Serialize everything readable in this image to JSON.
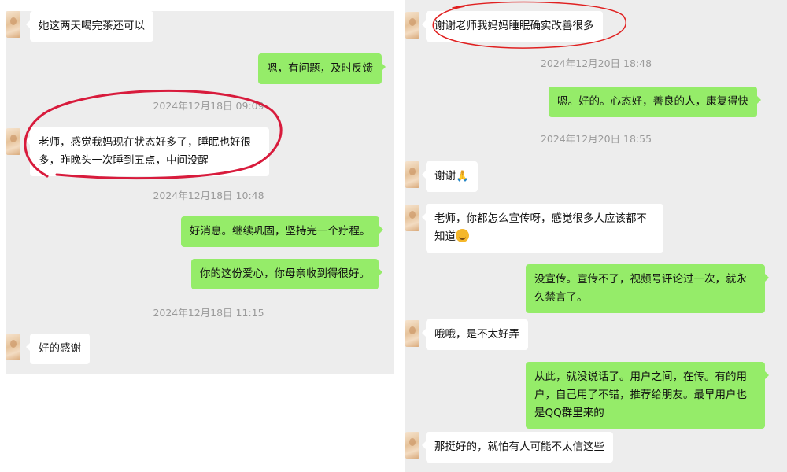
{
  "left": {
    "messages": [
      {
        "side": "in",
        "text": "她这两天喝完茶还可以"
      },
      {
        "side": "out",
        "text": "嗯，有问题，及时反馈"
      },
      {
        "type": "time",
        "text": "2024年12月18日 09:09"
      },
      {
        "side": "in",
        "text": "老师，感觉我妈现在状态好多了，睡眠也好很多，昨晚头一次睡到五点，中间没醒"
      },
      {
        "type": "time",
        "text": "2024年12月18日 10:48"
      },
      {
        "side": "out",
        "text": "好消息。继续巩固，坚持完一个疗程。"
      },
      {
        "side": "out",
        "text": "你的这份爱心，你母亲收到得很好。"
      },
      {
        "type": "time",
        "text": "2024年12月18日 11:15"
      },
      {
        "side": "in",
        "text": "好的感谢"
      }
    ]
  },
  "right": {
    "messages": [
      {
        "side": "in",
        "text": "谢谢老师我妈妈睡眠确实改善很多"
      },
      {
        "type": "time",
        "text": "2024年12月20日 18:48"
      },
      {
        "side": "out",
        "text": "嗯。好的。心态好，善良的人，康复得快"
      },
      {
        "type": "time",
        "text": "2024年12月20日 18:55"
      },
      {
        "side": "in",
        "text": "谢谢",
        "emoji": "🙏"
      },
      {
        "side": "in",
        "text": "老师，你都怎么宣传呀，感觉很多人应该都不知道",
        "emoji": "face-with-tongue"
      },
      {
        "side": "out",
        "text": "没宣传。宣传不了，视频号评论过一次，就永久禁言了。"
      },
      {
        "side": "in",
        "text": "哦哦，是不太好弄"
      },
      {
        "side": "out",
        "text": "从此，就没说话了。用户之间，在传。有的用户，自己用了不错，推荐给朋友。最早用户也是QQ群里来的"
      },
      {
        "side": "in",
        "text": "那挺好的，就怕有人可能不太信这些"
      }
    ]
  },
  "colors": {
    "panel_bg": "#ededed",
    "outgoing_bubble": "#95ec69",
    "incoming_bubble": "#ffffff",
    "annotation_red": "#d81b3c"
  },
  "icons": {
    "avatar": "contact-avatar-icon",
    "prayer": "folded-hands-emoji-icon",
    "tongue": "face-with-tongue-emoji-icon"
  }
}
